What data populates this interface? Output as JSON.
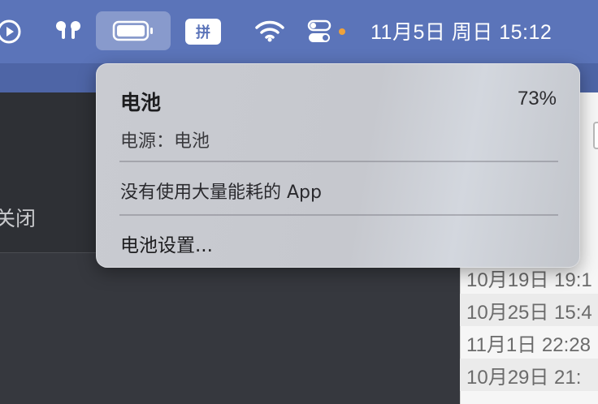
{
  "menubar": {
    "input_method": "拼",
    "clock": "11月5日 周日  15:12",
    "control_center_dot_color": "#f0a23a",
    "icons": [
      "play-icon",
      "airpods-icon",
      "battery-icon",
      "wifi-icon",
      "control-center-icon"
    ]
  },
  "popover": {
    "title": "电池",
    "percent": "73%",
    "power_source": "电源：电池",
    "no_apps": "没有使用大量能耗的 App",
    "settings": "电池设置..."
  },
  "background": {
    "close_label": "关闭",
    "dates": [
      "10月19日 19:1",
      "10月25日 15:4",
      "11月1日 22:28",
      "10月29日 21:"
    ]
  }
}
